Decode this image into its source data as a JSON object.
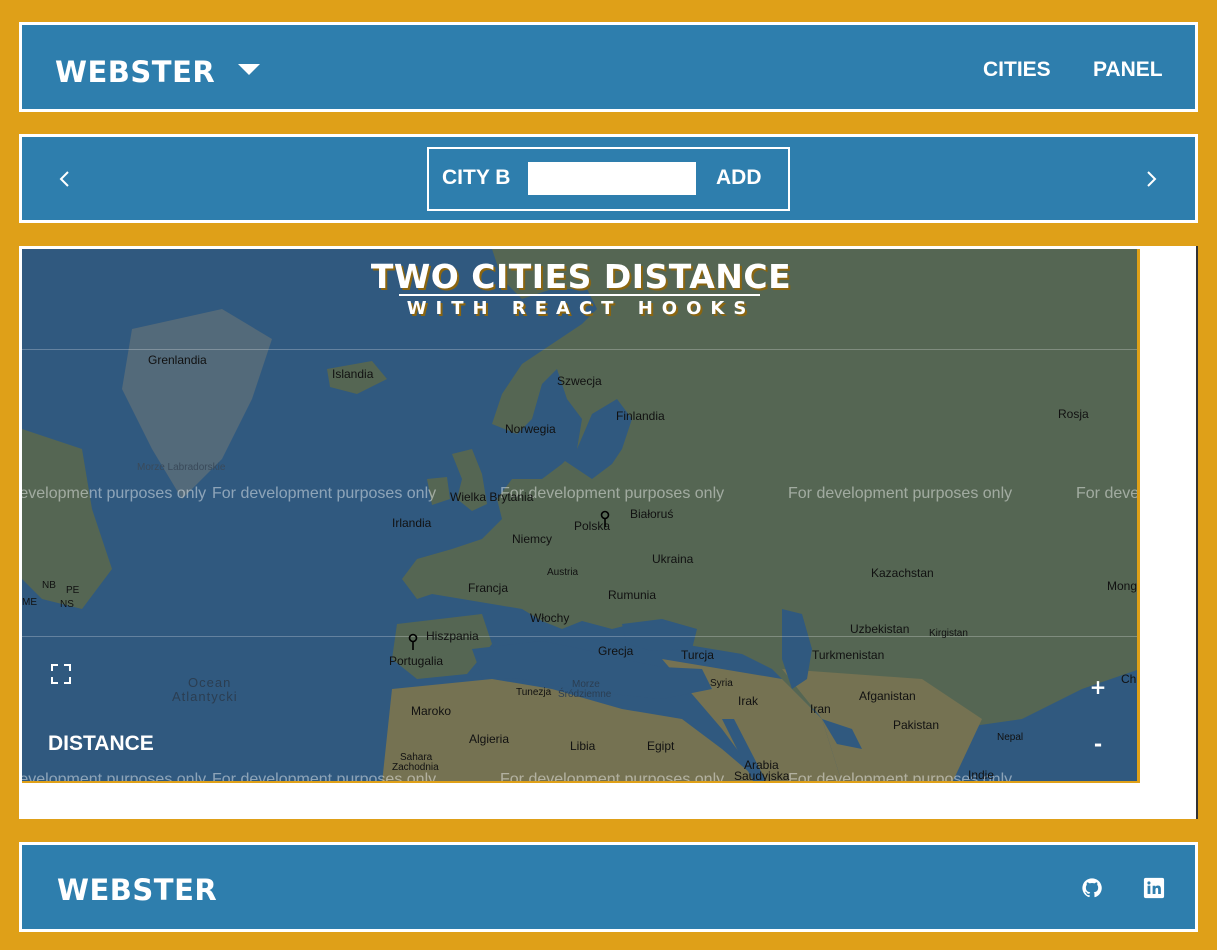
{
  "header": {
    "brand": "WEBSTER",
    "nav": [
      {
        "label": "CITIES"
      },
      {
        "label": "PANEL"
      }
    ],
    "dropdown_icon": "caret-down-icon"
  },
  "controls": {
    "prev_icon": "chevron-left-icon",
    "next_icon": "chevron-right-icon",
    "city_label": "CITY B",
    "city_input_value": "",
    "add_label": "ADD"
  },
  "map": {
    "title": "TWO CITIES DISTANCE",
    "subtitle": "WITH REACT HOOKS",
    "watermark": "For development purposes only",
    "distance_label": "DISTANCE",
    "zoom_in": "+",
    "zoom_out": "-",
    "places": {
      "grenlandia": "Grenlandia",
      "islandia": "Islandia",
      "szwecja": "Szwecja",
      "finlandia": "Finlandia",
      "norwegia": "Norwegia",
      "rosja": "Rosja",
      "morze_labradorskie": "Morze Labradorskie",
      "wielka_brytania": "Wielka Brytania",
      "irlandia": "Irlandia",
      "polska": "Polska",
      "bialorus": "Białoruś",
      "niemcy": "Niemcy",
      "ukraina": "Ukraina",
      "austria": "Austria",
      "francja": "Francja",
      "rumunia": "Rumunia",
      "kazachstan": "Kazachstan",
      "mong": "Mong",
      "wlochy": "Włochy",
      "nb": "NB",
      "pe": "PE",
      "me": "ME",
      "ns": "NS",
      "hiszpania": "Hiszpania",
      "portugalia": "Portugalia",
      "grecja": "Grecja",
      "turcja": "Turcja",
      "uzbekistan": "Uzbekistan",
      "kirgistan": "Kirgistan",
      "turkmenistan": "Turkmenistan",
      "ocean": "Ocean",
      "atlantycki": "Atlantycki",
      "tunezja": "Tunezja",
      "morze": "Morze",
      "srodziemne": "Śródziemne",
      "syria": "Syria",
      "afganistan": "Afganistan",
      "chi": "Chi",
      "maroko": "Maroko",
      "irak": "Irak",
      "iran": "Iran",
      "pakistan": "Pakistan",
      "algieria": "Algieria",
      "libia": "Libia",
      "egipt": "Egipt",
      "nepal": "Nepal",
      "sahara": "Sahara",
      "zachodnia": "Zachodnia",
      "arabia": "Arabia",
      "saudyjska": "Saudyjska",
      "indie": "Indie"
    }
  },
  "footer": {
    "brand": "WEBSTER",
    "icons": [
      "github-icon",
      "linkedin-icon"
    ]
  }
}
